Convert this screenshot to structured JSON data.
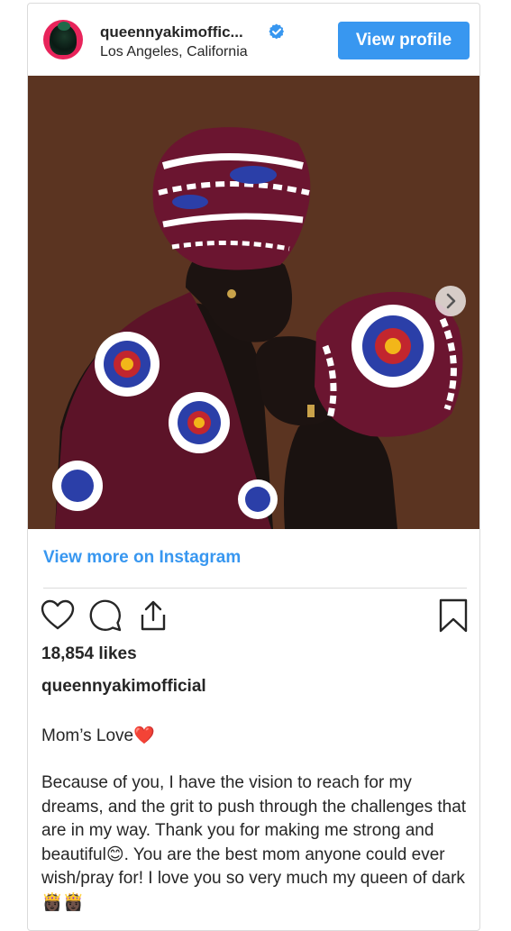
{
  "post": {
    "username": "queennyakimoffic...",
    "location": "Los Angeles, California",
    "view_profile_label": "View profile",
    "view_more_label": "View more on Instagram",
    "likes": "18,854 likes",
    "caption_user": "queennyakimofficial",
    "caption_title": "Mom’s Love❤️",
    "caption_body": "Because of you, I have the vision to reach for my dreams, and the grit to push through the challenges that are in my way. Thank you for making me strong and beautiful😊. You are the best mom anyone could ever wish/pray for! I love you so very much my queen of dark👸🏿👸🏿",
    "accent_color": "#3897f0",
    "icons": [
      "verified-badge-icon",
      "next-arrow-icon",
      "heart-icon",
      "comment-icon",
      "share-icon",
      "bookmark-icon"
    ]
  }
}
